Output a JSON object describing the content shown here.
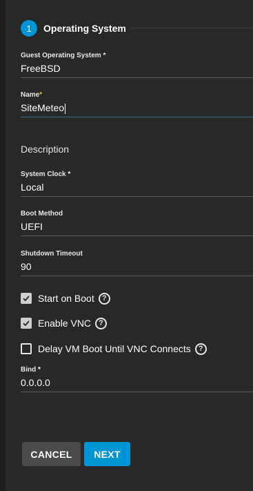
{
  "step": {
    "number": "1",
    "title": "Operating System"
  },
  "fields": {
    "guest_os": {
      "label": "Guest Operating System",
      "required": "*",
      "value": "FreeBSD"
    },
    "name": {
      "label": "Name",
      "required": "*",
      "value": "SiteMeteo"
    },
    "description": {
      "placeholder": "Description"
    },
    "system_clock": {
      "label": "System Clock",
      "required": "*",
      "value": "Local"
    },
    "boot_method": {
      "label": "Boot Method",
      "value": "UEFI"
    },
    "shutdown_timeout": {
      "label": "Shutdown Timeout",
      "value": "90"
    },
    "bind": {
      "label": "Bind",
      "required": "*",
      "value": "0.0.0.0"
    }
  },
  "checkboxes": {
    "start_on_boot": {
      "label": "Start on Boot",
      "checked": true
    },
    "enable_vnc": {
      "label": "Enable VNC",
      "checked": true
    },
    "delay_vm_boot": {
      "label": "Delay VM Boot Until VNC Connects",
      "checked": false
    }
  },
  "buttons": {
    "cancel": "CANCEL",
    "next": "NEXT"
  },
  "icons": {
    "help": "?",
    "check": "✓"
  },
  "colors": {
    "accent": "#0095d5",
    "background": "#282828",
    "required_name": "#f0c000"
  }
}
